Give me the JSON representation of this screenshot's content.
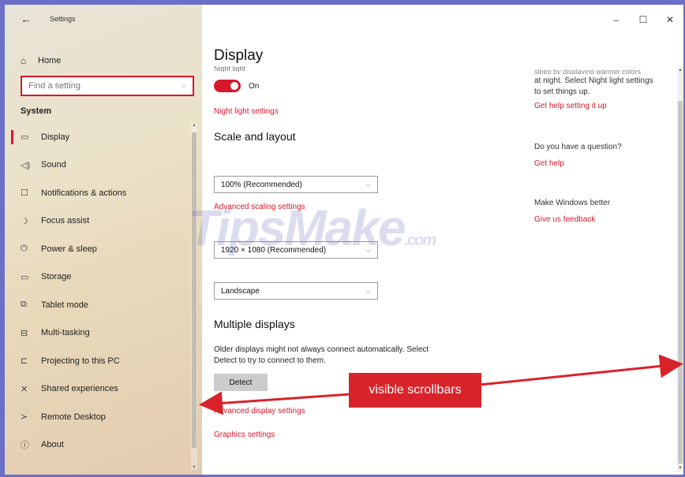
{
  "window": {
    "title": "Settings",
    "controls": {
      "minimize": "–",
      "maximize": "☐",
      "close": "✕"
    }
  },
  "sidebar": {
    "back_icon": "back-arrow-icon",
    "home": {
      "label": "Home",
      "icon": "home-icon"
    },
    "search": {
      "placeholder": "Find a setting",
      "icon": "search-icon"
    },
    "section_title": "System",
    "items": [
      {
        "label": "Display",
        "icon": "monitor-icon",
        "active": true
      },
      {
        "label": "Sound",
        "icon": "speaker-icon"
      },
      {
        "label": "Notifications & actions",
        "icon": "notification-icon"
      },
      {
        "label": "Focus assist",
        "icon": "moon-icon"
      },
      {
        "label": "Power & sleep",
        "icon": "power-icon"
      },
      {
        "label": "Storage",
        "icon": "storage-icon"
      },
      {
        "label": "Tablet mode",
        "icon": "tablet-icon"
      },
      {
        "label": "Multi-tasking",
        "icon": "multitasking-icon"
      },
      {
        "label": "Projecting to this PC",
        "icon": "projector-icon"
      },
      {
        "label": "Shared experiences",
        "icon": "shared-icon"
      },
      {
        "label": "Remote Desktop",
        "icon": "remote-icon"
      },
      {
        "label": "About",
        "icon": "info-icon"
      }
    ]
  },
  "main": {
    "page_title": "Display",
    "night_light_toggle": {
      "state": "On",
      "on": true
    },
    "night_light_link": "Night light settings",
    "scale_heading": "Scale and layout",
    "scale_dropdown": "100% (Recommended)",
    "advanced_scaling_link": "Advanced scaling settings",
    "resolution_dropdown": "1920 × 1080 (Recommended)",
    "orientation_dropdown": "Landscape",
    "multiple_heading": "Multiple displays",
    "multiple_text_line1": "Older displays might not always connect automatically. Select",
    "multiple_text_line2": "Detect to try to connect to them.",
    "detect_button": "Detect",
    "advanced_display_link": "Advanced display settings",
    "graphics_link": "Graphics settings"
  },
  "right_panel": {
    "night_line1": "at night. Select Night light settings",
    "night_line2": "to set things up.",
    "help_setting_link": "Get help setting it up",
    "question": "Do you have a question?",
    "get_help_link": "Get help",
    "make_better": "Make Windows better",
    "feedback_link": "Give us feedback"
  },
  "watermark": {
    "main": "TipsMake",
    "suffix": ".com"
  },
  "annotation": {
    "label": "visible scrollbars"
  },
  "colors": {
    "accent": "#d8182c",
    "annotation": "#d8232a",
    "frame": "#6b6fc7"
  }
}
